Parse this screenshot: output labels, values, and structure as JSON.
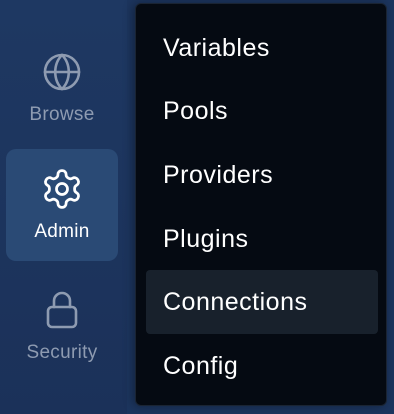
{
  "sidebar": {
    "items": [
      {
        "label": "Browse",
        "icon": "globe-icon",
        "active": false
      },
      {
        "label": "Admin",
        "icon": "gear-icon",
        "active": true
      },
      {
        "label": "Security",
        "icon": "lock-icon",
        "active": false
      }
    ]
  },
  "admin_menu": {
    "items": [
      {
        "label": "Variables"
      },
      {
        "label": "Pools"
      },
      {
        "label": "Providers"
      },
      {
        "label": "Plugins"
      },
      {
        "label": "Connections",
        "highlighted": true
      },
      {
        "label": "Config"
      }
    ]
  },
  "colors": {
    "sidebar_bg": "#1e3862",
    "active_item_bg": "#2a4a75",
    "menu_bg": "#050a12",
    "menu_hover_bg": "#18212c",
    "muted_text": "#8e9bb1",
    "text": "#ffffff"
  }
}
